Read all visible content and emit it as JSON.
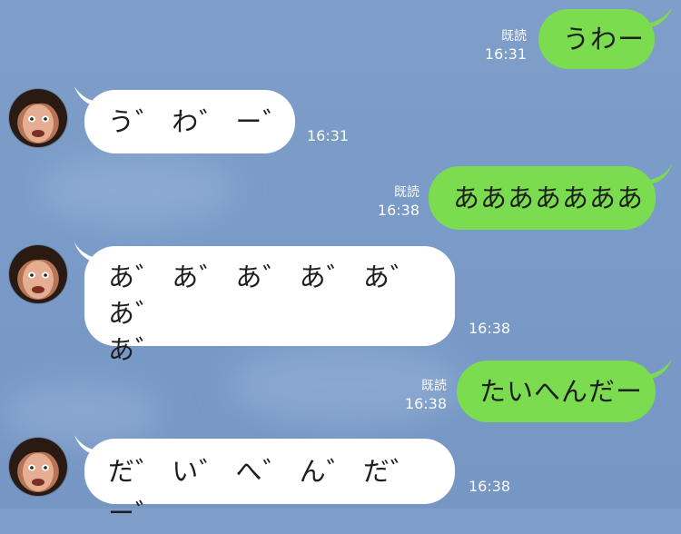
{
  "messages": [
    {
      "id": "m1",
      "direction": "outgoing",
      "text": "うわー",
      "read_label": "既読",
      "time": "16:31"
    },
    {
      "id": "m2",
      "direction": "incoming",
      "text": "う゛ わ゛ ー゛",
      "time": "16:31"
    },
    {
      "id": "m3",
      "direction": "outgoing",
      "text": "あああああああ",
      "read_label": "既読",
      "time": "16:38"
    },
    {
      "id": "m4",
      "direction": "incoming",
      "text_line1": "あ゛ あ゛ あ゛ あ゛ あ゛ あ゛",
      "text_line2": "あ゛",
      "time": "16:38"
    },
    {
      "id": "m5",
      "direction": "outgoing",
      "text": "たいへんだー",
      "read_label": "既読",
      "time": "16:38"
    },
    {
      "id": "m6",
      "direction": "incoming",
      "text": "だ゛ い゛ へ゛ ん゛ だ゛ ー゛",
      "time": "16:38"
    }
  ],
  "colors": {
    "background": "#7a9bc8",
    "outgoing_bubble": "#7bdc4f",
    "incoming_bubble": "#ffffff",
    "meta_text": "#ffffff"
  },
  "icons": {
    "avatar": "sender-avatar"
  }
}
